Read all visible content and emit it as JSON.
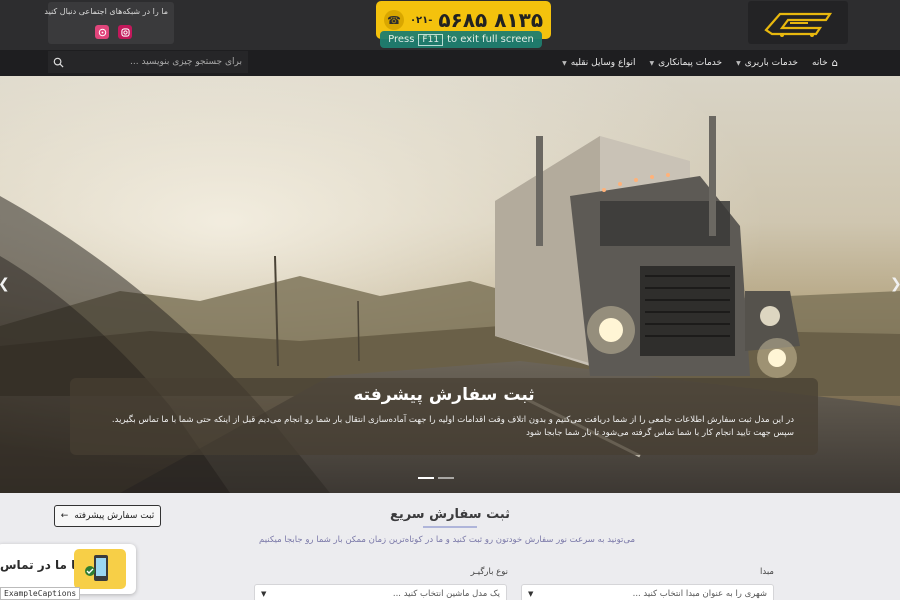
{
  "header": {
    "phone_prefix": "۰۲۱-",
    "phone_number": "۵۶۸۵ ۸۱۳۵",
    "fullscreen_toast": {
      "before": "Press",
      "key": "F11",
      "after": "to exit full screen"
    },
    "social_label": "ما را در شبکه‌های اجتماعی دنبال کنید",
    "social_icons": [
      "instagram-icon",
      "aparat-icon"
    ]
  },
  "nav": {
    "items": [
      {
        "label": "خانه",
        "icon": "home-icon"
      },
      {
        "label": "خدمات باربری"
      },
      {
        "label": "خدمات پیمانکاری"
      },
      {
        "label": "انواع وسایل نقلیه"
      }
    ]
  },
  "search": {
    "placeholder": "برای جستجو چیزی بنویسید ..."
  },
  "hero": {
    "title": "ثبت سفارش پیشرفته",
    "text": "در این مدل ثبت سفارش اطلاعات جامعی را از شما دریافت می‌کنیم و بدون اتلاف وقت اقدامات اولیه را جهت آماده‌سازی انتقال بار شما رو انجام می‌دیم قبل از اینکه حتی شما با ما تماس بگیرید. سپس جهت تایید انجام کار با شما تماس گرفته می‌شود تا بار شما جابجا شود",
    "slides": 2,
    "active_slide": 0
  },
  "order": {
    "title": "ثبت سفارش سریع",
    "subtitle": "می‌تونید به سرعت نور سفارش خودتون رو ثبت کنید و ما در کوتاه‌ترین زمان ممکن بار شما رو جابجا میکنیم",
    "advanced_button": "ثبت سفارش پیشرفته",
    "origin_label": "مبدا",
    "origin_value": "شهری را به عنوان مبدا انتخاب کنید ...",
    "load_type_label": "نوع بارگیـر",
    "load_type_value": "یک مدل ماشین انتخاب کنید ..."
  },
  "contact_widget": {
    "label": "با ما در تماس"
  },
  "watermark": "ExampleCaptions",
  "colors": {
    "accent_yellow": "#f4c20d",
    "header_dark": "#2d2d2f",
    "nav_dark": "#1e1e20"
  }
}
